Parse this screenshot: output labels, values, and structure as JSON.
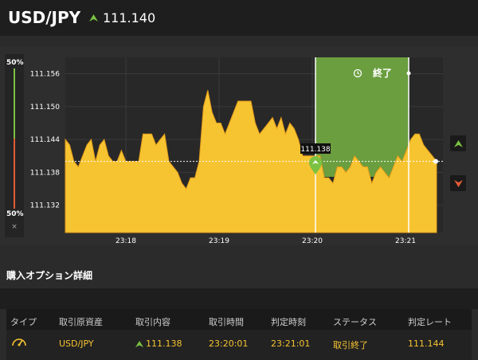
{
  "header": {
    "pair": "USD/JPY",
    "rate": "111.140",
    "rate_icon": "up-arrow-icon"
  },
  "colors": {
    "up": "#7cc242",
    "down": "#e25b36",
    "area": "#f7c431",
    "window": "#6a9e3f",
    "bg": "#2e2e2e"
  },
  "sidebar": {
    "top_pct": "50%",
    "bottom_pct": "50%",
    "close": "×"
  },
  "chart": {
    "marker_label": "111.138",
    "end_label": "終了",
    "end_icon": "clock-icon",
    "up_button_icon": "up-arrow-icon",
    "down_button_icon": "down-arrow-icon"
  },
  "chart_data": {
    "type": "area",
    "y_ticks": [
      "111.156",
      "111.150",
      "111.144",
      "111.138",
      "111.132"
    ],
    "x_ticks": [
      "23:18",
      "23:19",
      "23:20",
      "23:21"
    ],
    "ylim": [
      111.127,
      111.159
    ],
    "current_rate": 111.14,
    "entry_time": "23:20:01",
    "expiry_time": "23:21:01",
    "values": [
      111.144,
      111.143,
      111.14,
      111.139,
      111.141,
      111.143,
      111.144,
      111.14,
      111.143,
      111.144,
      111.141,
      111.14,
      111.14,
      111.142,
      111.14,
      111.14,
      111.14,
      111.14,
      111.145,
      111.145,
      111.145,
      111.143,
      111.144,
      111.145,
      111.14,
      111.139,
      111.138,
      111.136,
      111.135,
      111.137,
      111.137,
      111.14,
      111.15,
      111.153,
      111.149,
      111.147,
      111.147,
      111.145,
      111.147,
      111.149,
      111.151,
      111.151,
      111.151,
      111.151,
      111.147,
      111.145,
      111.146,
      111.147,
      111.148,
      111.146,
      111.148,
      111.145,
      111.147,
      111.146,
      111.144,
      111.141,
      111.141,
      111.141,
      111.141,
      111.141,
      111.137,
      111.137,
      111.136,
      111.139,
      111.139,
      111.138,
      111.139,
      111.141,
      111.14,
      111.139,
      111.139,
      111.136,
      111.138,
      111.139,
      111.138,
      111.137,
      111.139,
      111.141,
      111.14,
      111.142,
      111.144,
      111.145,
      111.145,
      111.143,
      111.142,
      111.141,
      111.14
    ]
  },
  "details": {
    "title": "購入オプション詳細",
    "headers": [
      "タイプ",
      "取引原資産",
      "取引内容",
      "取引時間",
      "判定時刻",
      "ステータス",
      "判定レート"
    ],
    "row": {
      "type_icon": "gauge-icon",
      "asset": "USD/JPY",
      "direction_icon": "up-arrow-icon",
      "rate": "111.138",
      "trade_time": "23:20:01",
      "judge_time": "23:21:01",
      "status": "取引終了",
      "judge_rate": "111.144"
    }
  }
}
